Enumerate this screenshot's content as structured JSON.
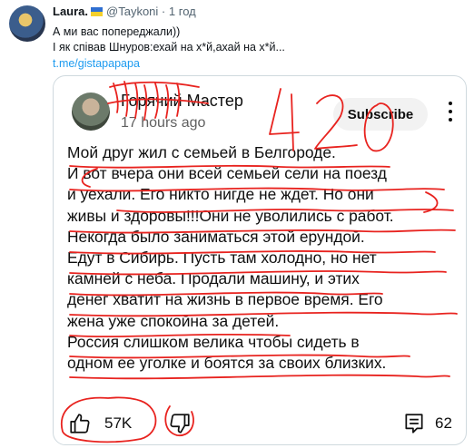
{
  "tweet": {
    "author_name": "Laura.",
    "handle": "@Taykoni",
    "separator": "·",
    "time": "1 год",
    "line1": "А ми вас попереджали))",
    "line2": "І як співав Шнуров:ехай на х*й,ахай на х*й...",
    "link": "t.me/gistapapapa"
  },
  "embedded_post": {
    "channel_name": "Горячий Мастер",
    "time": "17 hours ago",
    "subscribe_label": "Subscribe",
    "body_lines": [
      "Мой  друг  жил с семьей в  Белгороде.",
      "И вот вчера они всей семьей  сели  на поезд",
      "и уехали. Его никто  нигде  не  ждет. Но они",
      "живы и  здоровы!!!Они не уволились с работ.",
      "Некогда  было  заниматься этой ерундой.",
      "Едут в Сибирь. Пусть  там  холодно, но нет",
      "камней с неба. Продали машину, и  этих",
      "денег  хватит на  жизнь в первое время. Его",
      "жена уже спокойна за  детей.",
      "Россия слишком велика чтобы сидеть в",
      "одном ее уголке и боятся за своих близких."
    ],
    "like_count": "57K",
    "comment_count": "62",
    "handwritten_overlay": "4 20"
  },
  "colors": {
    "annotation_red": "#e8231f",
    "link_blue": "#1d9bf0",
    "muted_gray": "#536471"
  },
  "icons": [
    "ukraine-flag-icon",
    "more-options-icon",
    "thumbs-up-icon",
    "thumbs-down-icon",
    "comment-icon"
  ]
}
